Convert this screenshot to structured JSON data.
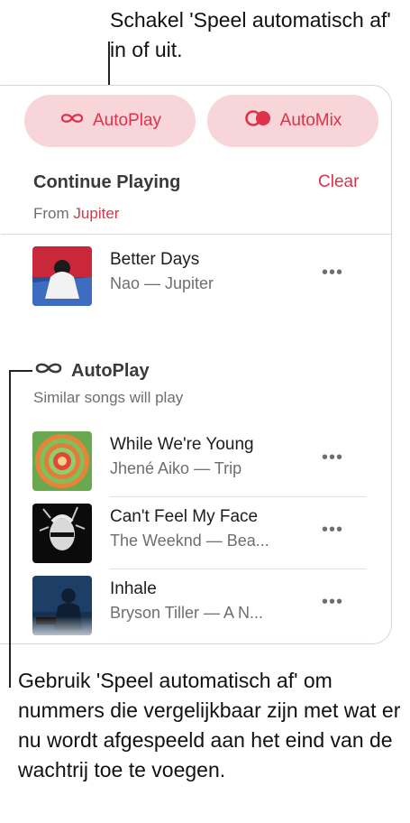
{
  "callouts": {
    "top": "Schakel 'Speel automatisch af' in of uit.",
    "bottom": "Gebruik 'Speel automatisch af' om nummers die vergelijkbaar zijn met wat er nu wordt afgespeeld aan het eind van de wachtrij toe te voegen."
  },
  "toggles": {
    "autoplay_label": "AutoPlay",
    "automix_label": "AutoMix",
    "autoplay_icon": "infinity-icon",
    "automix_icon": "automix-icon"
  },
  "continue_playing": {
    "title": "Continue Playing",
    "clear_label": "Clear",
    "from_label": "From",
    "from_source": "Jupiter",
    "items": [
      {
        "title": "Better Days",
        "subtitle": "Nao — Jupiter",
        "more": "•••"
      }
    ]
  },
  "autoplay_section": {
    "title": "AutoPlay",
    "subtitle": "Similar songs will play",
    "items": [
      {
        "title": "While We're Young",
        "subtitle": "Jhené Aiko — Trip",
        "more": "•••"
      },
      {
        "title": "Can't Feel My Face",
        "subtitle": "The Weeknd — Bea...",
        "more": "•••"
      },
      {
        "title": "Inhale",
        "subtitle": "Bryson Tiller — A N...",
        "more": "•••"
      }
    ]
  },
  "colors": {
    "accent": "#e0314b",
    "pill_background": "#f7d5d9"
  }
}
